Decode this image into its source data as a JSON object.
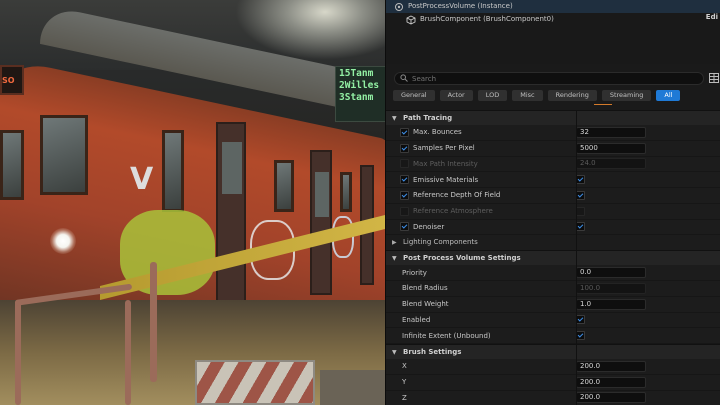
{
  "viewport": {
    "number_plate": "SO",
    "destination_lines": [
      "15Tanm",
      "2Willes",
      "3Stanm"
    ],
    "train_logo": "V"
  },
  "outliner": {
    "root_label": "PostProcessVolume (Instance)",
    "child_label": "BrushComponent (BrushComponent0)",
    "edit_label": "Edi"
  },
  "search": {
    "placeholder": "Search"
  },
  "filters": [
    "General",
    "Actor",
    "LOD",
    "Misc",
    "Rendering",
    "Streaming",
    "All"
  ],
  "active_filter": "All",
  "path_tracing": {
    "title": "Path Tracing",
    "max_bounces": {
      "label": "Max. Bounces",
      "value": "32",
      "enabled": true
    },
    "samples_per_pixel": {
      "label": "Samples Per Pixel",
      "value": "5000",
      "enabled": true
    },
    "max_path_intensity": {
      "label": "Max Path Intensity",
      "value": "24.0",
      "enabled": false
    },
    "emissive_materials": {
      "label": "Emissive Materials",
      "enabled": true,
      "checked": true
    },
    "reference_dof": {
      "label": "Reference Depth Of Field",
      "enabled": true,
      "checked": true
    },
    "reference_atmosphere": {
      "label": "Reference Atmosphere",
      "enabled": false,
      "checked": false
    },
    "denoiser": {
      "label": "Denoiser",
      "enabled": true,
      "checked": true
    }
  },
  "lighting_components": {
    "title": "Lighting Components"
  },
  "ppv_settings": {
    "title": "Post Process Volume Settings",
    "priority": {
      "label": "Priority",
      "value": "0.0"
    },
    "blend_radius": {
      "label": "Blend Radius",
      "value": "100.0"
    },
    "blend_weight": {
      "label": "Blend Weight",
      "value": "1.0"
    },
    "enabled": {
      "label": "Enabled",
      "checked": true
    },
    "infinite_extent": {
      "label": "Infinite Extent (Unbound)",
      "checked": true
    }
  },
  "brush_settings": {
    "title": "Brush Settings",
    "x": {
      "label": "X",
      "value": "200.0"
    },
    "y": {
      "label": "Y",
      "value": "200.0"
    },
    "z": {
      "label": "Z",
      "value": "200.0"
    }
  },
  "colors": {
    "accent": "#1f7ad6",
    "check": "#3d8ee8",
    "panel_bg": "#1a1a1a",
    "sign_text": "#93f0a4"
  }
}
